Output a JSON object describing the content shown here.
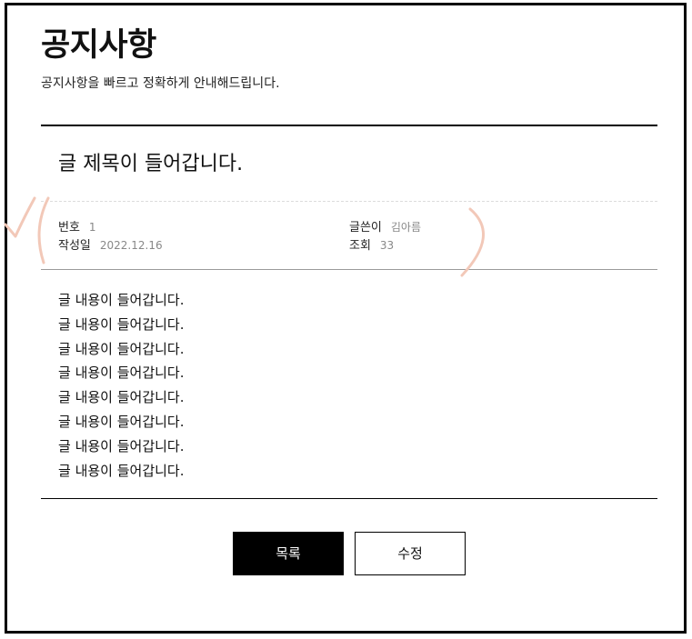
{
  "header": {
    "title": "공지사항",
    "subtitle": "공지사항을 빠르고 정확하게 안내해드립니다."
  },
  "post": {
    "title": "글 제목이 들어갑니다.",
    "meta": {
      "number_label": "번호",
      "number_value": "1",
      "date_label": "작성일",
      "date_value": "2022.12.16",
      "author_label": "글쓴이",
      "author_value": "김아름",
      "views_label": "조회",
      "views_value": "33"
    },
    "content_lines": [
      "글 내용이 들어갑니다.",
      "글 내용이 들어갑니다.",
      "글 내용이 들어갑니다.",
      "글 내용이 들어갑니다.",
      "글 내용이 들어갑니다.",
      "글 내용이 들어갑니다.",
      "글 내용이 들어갑니다.",
      "글 내용이 들어갑니다."
    ]
  },
  "buttons": {
    "list_label": "목록",
    "edit_label": "수정"
  },
  "colors": {
    "annotation_stroke": "#f2c8b8",
    "primary_button_bg": "#000000",
    "meta_value": "#888888"
  }
}
